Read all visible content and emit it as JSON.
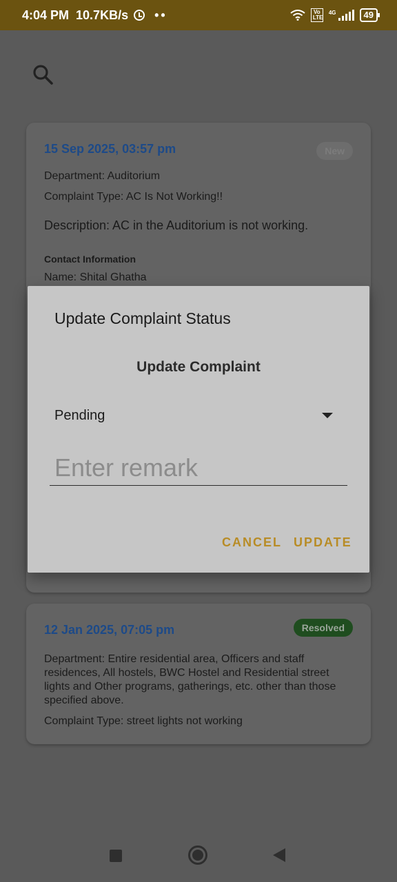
{
  "status_bar": {
    "time": "4:04 PM",
    "speed": "10.7KB/s",
    "dots": "••",
    "volte": "Vo LTE",
    "network": "4G",
    "battery": "49"
  },
  "cards": [
    {
      "date": "15 Sep 2025, 03:57 pm",
      "badge": "New",
      "department": "Department: Auditorium",
      "complaint_type": "Complaint Type: AC Is Not Working!!",
      "description": "Description: AC in the Auditorium is not working.",
      "contact_heading": "Contact Information",
      "name": "Name: Shital Ghatha"
    },
    {
      "date": "12 Jan 2025, 07:05 pm",
      "badge": "Resolved",
      "department": "Department: Entire residential area, Officers and staff residences, All hostels, BWC Hostel and Residential street lights and Other programs, gatherings, etc. other than those specified above.",
      "complaint_type": "Complaint Type: street lights not working"
    }
  ],
  "dialog": {
    "title": "Update Complaint Status",
    "subtitle": "Update Complaint",
    "selected_status": "Pending",
    "remark_placeholder": "Enter remark",
    "cancel_label": "CANCEL",
    "update_label": "UPDATE"
  },
  "colors": {
    "status_bar": "#6b5310",
    "accent_button": "#b88c26",
    "date_text": "#1d4a88",
    "resolved_badge": "#1f4d1f"
  }
}
